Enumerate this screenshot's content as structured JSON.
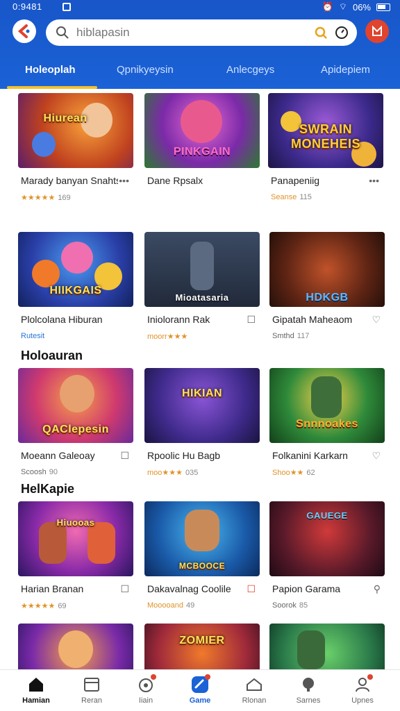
{
  "status": {
    "time": "0:9481",
    "battery": "06%"
  },
  "search": {
    "placeholder": "hiblapasin"
  },
  "tabs": [
    "Holeoplah",
    "Qpnikyeysin",
    "Anlecgeys",
    "Apidepiem"
  ],
  "row1": [
    {
      "name": "Marady banyan Snahts",
      "meta": "★★★★★",
      "num": "169",
      "art": "Hiurean"
    },
    {
      "name": "Dane Rpsalx",
      "meta": "",
      "num": "",
      "art": "PINKGAIN"
    },
    {
      "name": "Panapeniig",
      "meta": "Seanse",
      "num": "115",
      "art": "SWRAIN MONEHEIS"
    }
  ],
  "row2": [
    {
      "name": "Plolcolana Hiburan",
      "meta": "Rutesit",
      "num": "",
      "art": "HIIKGAIS"
    },
    {
      "name": "Iniolorann Rak",
      "meta": "moorr★★★",
      "num": "",
      "art": "Mioatasaria"
    },
    {
      "name": "Gipatah Maheaom",
      "meta": "Smthd",
      "num": "117",
      "art": "HDKGB"
    }
  ],
  "section1": "Holoauran",
  "row3": [
    {
      "name": "Moeann Galeoay",
      "meta": "Scoosh",
      "num": "90",
      "art": "QAClepesin"
    },
    {
      "name": "Rpoolic Hu Bagb",
      "meta": "moo★★★",
      "num": "035",
      "art": "HIKIAN"
    },
    {
      "name": "Folkanini Karkarn",
      "meta": "Shoo★★",
      "num": "62",
      "art": "Snnnoakes"
    }
  ],
  "section2": "HelKapie",
  "row4": [
    {
      "name": "Harian Branan",
      "meta": "★★★★★",
      "num": "69",
      "art": "Hiuooas"
    },
    {
      "name": "Dakavalnag Coolile",
      "meta": "Mooooand",
      "num": "49",
      "art": "MCBOOCE"
    },
    {
      "name": "Papion Garama",
      "meta": "Soorok",
      "num": "85",
      "art": "GAUEGE"
    }
  ],
  "row5": [
    {
      "art": ""
    },
    {
      "art": "ZOMIER"
    },
    {
      "art": ""
    }
  ],
  "nav": [
    {
      "label": "Hamian",
      "icon": "home-icon"
    },
    {
      "label": "Reran",
      "icon": "list-icon"
    },
    {
      "label": "Iiain",
      "icon": "gamepad-icon"
    },
    {
      "label": "Game",
      "icon": "game-icon"
    },
    {
      "label": "Rlonan",
      "icon": "inbox-icon"
    },
    {
      "label": "Sarnes",
      "icon": "chat-icon"
    },
    {
      "label": "Upnes",
      "icon": "user-icon"
    }
  ],
  "colors": {
    "header": "#1a62d6",
    "accent": "#f4c22e",
    "badge": "#e0432e"
  }
}
